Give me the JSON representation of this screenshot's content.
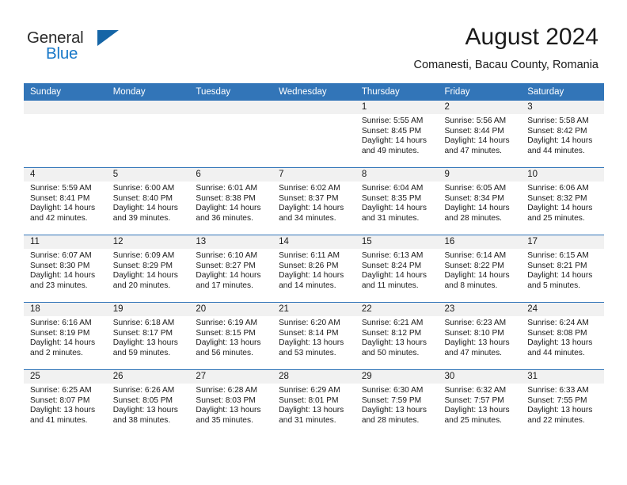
{
  "brand": {
    "name_part1": "General",
    "name_part2": "Blue",
    "logo_color": "#1565a6",
    "accent_color": "#1878c8"
  },
  "header": {
    "title": "August 2024",
    "subtitle": "Comanesti, Bacau County, Romania"
  },
  "calendar": {
    "header_bg": "#3275b8",
    "header_text_color": "#ffffff",
    "daynum_band_bg": "#f1f1f1",
    "weekday_headers": [
      "Sunday",
      "Monday",
      "Tuesday",
      "Wednesday",
      "Thursday",
      "Friday",
      "Saturday"
    ],
    "weeks": [
      [
        {
          "day": "",
          "empty": true
        },
        {
          "day": "",
          "empty": true
        },
        {
          "day": "",
          "empty": true
        },
        {
          "day": "",
          "empty": true
        },
        {
          "day": "1",
          "sunrise": "Sunrise: 5:55 AM",
          "sunset": "Sunset: 8:45 PM",
          "daylight_line1": "Daylight: 14 hours",
          "daylight_line2": "and 49 minutes."
        },
        {
          "day": "2",
          "sunrise": "Sunrise: 5:56 AM",
          "sunset": "Sunset: 8:44 PM",
          "daylight_line1": "Daylight: 14 hours",
          "daylight_line2": "and 47 minutes."
        },
        {
          "day": "3",
          "sunrise": "Sunrise: 5:58 AM",
          "sunset": "Sunset: 8:42 PM",
          "daylight_line1": "Daylight: 14 hours",
          "daylight_line2": "and 44 minutes."
        }
      ],
      [
        {
          "day": "4",
          "sunrise": "Sunrise: 5:59 AM",
          "sunset": "Sunset: 8:41 PM",
          "daylight_line1": "Daylight: 14 hours",
          "daylight_line2": "and 42 minutes."
        },
        {
          "day": "5",
          "sunrise": "Sunrise: 6:00 AM",
          "sunset": "Sunset: 8:40 PM",
          "daylight_line1": "Daylight: 14 hours",
          "daylight_line2": "and 39 minutes."
        },
        {
          "day": "6",
          "sunrise": "Sunrise: 6:01 AM",
          "sunset": "Sunset: 8:38 PM",
          "daylight_line1": "Daylight: 14 hours",
          "daylight_line2": "and 36 minutes."
        },
        {
          "day": "7",
          "sunrise": "Sunrise: 6:02 AM",
          "sunset": "Sunset: 8:37 PM",
          "daylight_line1": "Daylight: 14 hours",
          "daylight_line2": "and 34 minutes."
        },
        {
          "day": "8",
          "sunrise": "Sunrise: 6:04 AM",
          "sunset": "Sunset: 8:35 PM",
          "daylight_line1": "Daylight: 14 hours",
          "daylight_line2": "and 31 minutes."
        },
        {
          "day": "9",
          "sunrise": "Sunrise: 6:05 AM",
          "sunset": "Sunset: 8:34 PM",
          "daylight_line1": "Daylight: 14 hours",
          "daylight_line2": "and 28 minutes."
        },
        {
          "day": "10",
          "sunrise": "Sunrise: 6:06 AM",
          "sunset": "Sunset: 8:32 PM",
          "daylight_line1": "Daylight: 14 hours",
          "daylight_line2": "and 25 minutes."
        }
      ],
      [
        {
          "day": "11",
          "sunrise": "Sunrise: 6:07 AM",
          "sunset": "Sunset: 8:30 PM",
          "daylight_line1": "Daylight: 14 hours",
          "daylight_line2": "and 23 minutes."
        },
        {
          "day": "12",
          "sunrise": "Sunrise: 6:09 AM",
          "sunset": "Sunset: 8:29 PM",
          "daylight_line1": "Daylight: 14 hours",
          "daylight_line2": "and 20 minutes."
        },
        {
          "day": "13",
          "sunrise": "Sunrise: 6:10 AM",
          "sunset": "Sunset: 8:27 PM",
          "daylight_line1": "Daylight: 14 hours",
          "daylight_line2": "and 17 minutes."
        },
        {
          "day": "14",
          "sunrise": "Sunrise: 6:11 AM",
          "sunset": "Sunset: 8:26 PM",
          "daylight_line1": "Daylight: 14 hours",
          "daylight_line2": "and 14 minutes."
        },
        {
          "day": "15",
          "sunrise": "Sunrise: 6:13 AM",
          "sunset": "Sunset: 8:24 PM",
          "daylight_line1": "Daylight: 14 hours",
          "daylight_line2": "and 11 minutes."
        },
        {
          "day": "16",
          "sunrise": "Sunrise: 6:14 AM",
          "sunset": "Sunset: 8:22 PM",
          "daylight_line1": "Daylight: 14 hours",
          "daylight_line2": "and 8 minutes."
        },
        {
          "day": "17",
          "sunrise": "Sunrise: 6:15 AM",
          "sunset": "Sunset: 8:21 PM",
          "daylight_line1": "Daylight: 14 hours",
          "daylight_line2": "and 5 minutes."
        }
      ],
      [
        {
          "day": "18",
          "sunrise": "Sunrise: 6:16 AM",
          "sunset": "Sunset: 8:19 PM",
          "daylight_line1": "Daylight: 14 hours",
          "daylight_line2": "and 2 minutes."
        },
        {
          "day": "19",
          "sunrise": "Sunrise: 6:18 AM",
          "sunset": "Sunset: 8:17 PM",
          "daylight_line1": "Daylight: 13 hours",
          "daylight_line2": "and 59 minutes."
        },
        {
          "day": "20",
          "sunrise": "Sunrise: 6:19 AM",
          "sunset": "Sunset: 8:15 PM",
          "daylight_line1": "Daylight: 13 hours",
          "daylight_line2": "and 56 minutes."
        },
        {
          "day": "21",
          "sunrise": "Sunrise: 6:20 AM",
          "sunset": "Sunset: 8:14 PM",
          "daylight_line1": "Daylight: 13 hours",
          "daylight_line2": "and 53 minutes."
        },
        {
          "day": "22",
          "sunrise": "Sunrise: 6:21 AM",
          "sunset": "Sunset: 8:12 PM",
          "daylight_line1": "Daylight: 13 hours",
          "daylight_line2": "and 50 minutes."
        },
        {
          "day": "23",
          "sunrise": "Sunrise: 6:23 AM",
          "sunset": "Sunset: 8:10 PM",
          "daylight_line1": "Daylight: 13 hours",
          "daylight_line2": "and 47 minutes."
        },
        {
          "day": "24",
          "sunrise": "Sunrise: 6:24 AM",
          "sunset": "Sunset: 8:08 PM",
          "daylight_line1": "Daylight: 13 hours",
          "daylight_line2": "and 44 minutes."
        }
      ],
      [
        {
          "day": "25",
          "sunrise": "Sunrise: 6:25 AM",
          "sunset": "Sunset: 8:07 PM",
          "daylight_line1": "Daylight: 13 hours",
          "daylight_line2": "and 41 minutes."
        },
        {
          "day": "26",
          "sunrise": "Sunrise: 6:26 AM",
          "sunset": "Sunset: 8:05 PM",
          "daylight_line1": "Daylight: 13 hours",
          "daylight_line2": "and 38 minutes."
        },
        {
          "day": "27",
          "sunrise": "Sunrise: 6:28 AM",
          "sunset": "Sunset: 8:03 PM",
          "daylight_line1": "Daylight: 13 hours",
          "daylight_line2": "and 35 minutes."
        },
        {
          "day": "28",
          "sunrise": "Sunrise: 6:29 AM",
          "sunset": "Sunset: 8:01 PM",
          "daylight_line1": "Daylight: 13 hours",
          "daylight_line2": "and 31 minutes."
        },
        {
          "day": "29",
          "sunrise": "Sunrise: 6:30 AM",
          "sunset": "Sunset: 7:59 PM",
          "daylight_line1": "Daylight: 13 hours",
          "daylight_line2": "and 28 minutes."
        },
        {
          "day": "30",
          "sunrise": "Sunrise: 6:32 AM",
          "sunset": "Sunset: 7:57 PM",
          "daylight_line1": "Daylight: 13 hours",
          "daylight_line2": "and 25 minutes."
        },
        {
          "day": "31",
          "sunrise": "Sunrise: 6:33 AM",
          "sunset": "Sunset: 7:55 PM",
          "daylight_line1": "Daylight: 13 hours",
          "daylight_line2": "and 22 minutes."
        }
      ]
    ]
  }
}
